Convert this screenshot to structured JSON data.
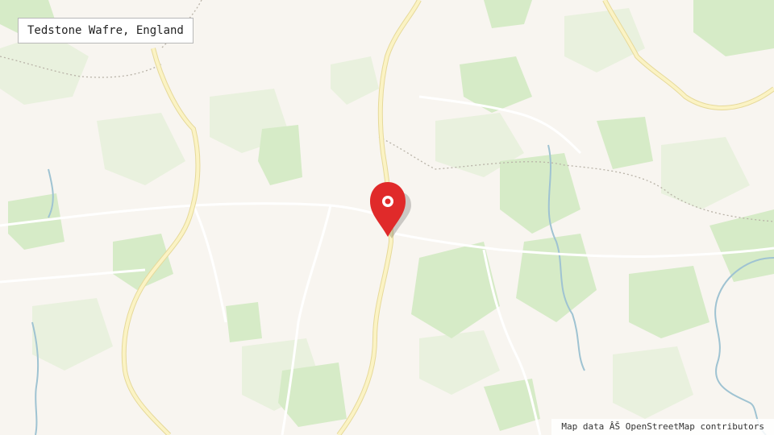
{
  "location_label": "Tedstone Wafre, England",
  "attribution": "Map data ÂŠ OpenStreetMap contributors",
  "colors": {
    "land": "#f8f5f0",
    "woodland": "#d6ebc7",
    "field": "#e9f1de",
    "road_main_fill": "#fbf3c4",
    "road_main_casing": "#e6d99a",
    "road_minor": "#ffffff",
    "water": "#9fc3d2",
    "boundary": "#b9b3a8",
    "marker": "#e02a2a",
    "marker_dot": "#ffffff"
  },
  "marker": {
    "icon": "map-pin-icon"
  }
}
